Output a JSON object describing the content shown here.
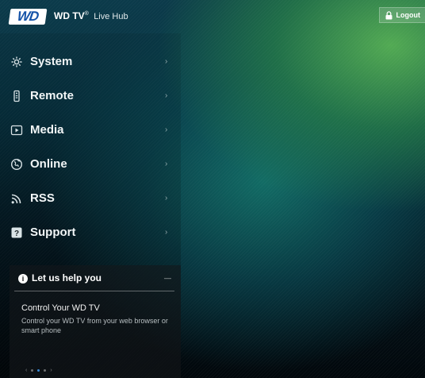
{
  "header": {
    "logo_text": "WD",
    "brand": "WD TV",
    "registered": "®",
    "product": "Live Hub",
    "logout_label": "Logout"
  },
  "menu": [
    {
      "label": "System",
      "icon": "gear-icon"
    },
    {
      "label": "Remote",
      "icon": "remote-icon"
    },
    {
      "label": "Media",
      "icon": "media-icon"
    },
    {
      "label": "Online",
      "icon": "globe-icon"
    },
    {
      "label": "RSS",
      "icon": "rss-icon"
    },
    {
      "label": "Support",
      "icon": "help-icon"
    }
  ],
  "menu_chevron": "›",
  "help": {
    "title": "Let us help you",
    "info_glyph": "i",
    "collapse_glyph": "—",
    "subtitle": "Control Your WD TV",
    "body": "Control your WD TV from your web browser or smart phone",
    "carousel": {
      "prev": "‹",
      "next": "›",
      "pages": 3,
      "active": 1
    }
  },
  "colors": {
    "accent": "#3a8bd8",
    "logo_blue": "#1553a8"
  }
}
